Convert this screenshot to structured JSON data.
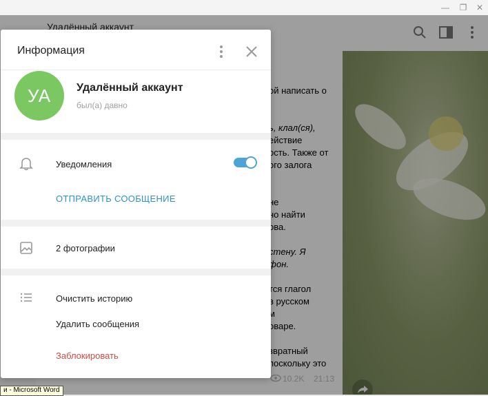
{
  "window": {
    "minimize_glyph": "—",
    "restore_glyph": "❐",
    "close_glyph": "✕"
  },
  "chat": {
    "header_title": "Удалённый аккаунт",
    "visible_lines": [
      "ой написать о",
      "ь, клал(ся),",
      "ействие",
      "ость. Также от",
      "ого залога",
      "не",
      "но найти",
      "ова.",
      "стену. Я",
      "фон.",
      "тся глагол",
      "в русском",
      "м",
      "оваре.",
      "звратный",
      "поскольку это"
    ],
    "views": "10.2K",
    "time": "21:13"
  },
  "dialog": {
    "title": "Информация",
    "avatar_initials": "УА",
    "profile_name": "Удалённый аккаунт",
    "profile_status": "был(а) давно",
    "notifications_label": "Уведомления",
    "notifications_enabled": true,
    "send_message": "ОТПРАВИТЬ СООБЩЕНИЕ",
    "photos_label": "2 фотографии",
    "clear_history": "Очистить историю",
    "delete_messages": "Удалить сообщения",
    "block": "Заблокировать"
  },
  "statusbar": {
    "text": "и - Microsoft Word"
  },
  "colors": {
    "avatar": "#7bc862",
    "accent": "#2e92c7",
    "danger": "#d24a43",
    "toggle": "#4ea4d9"
  }
}
